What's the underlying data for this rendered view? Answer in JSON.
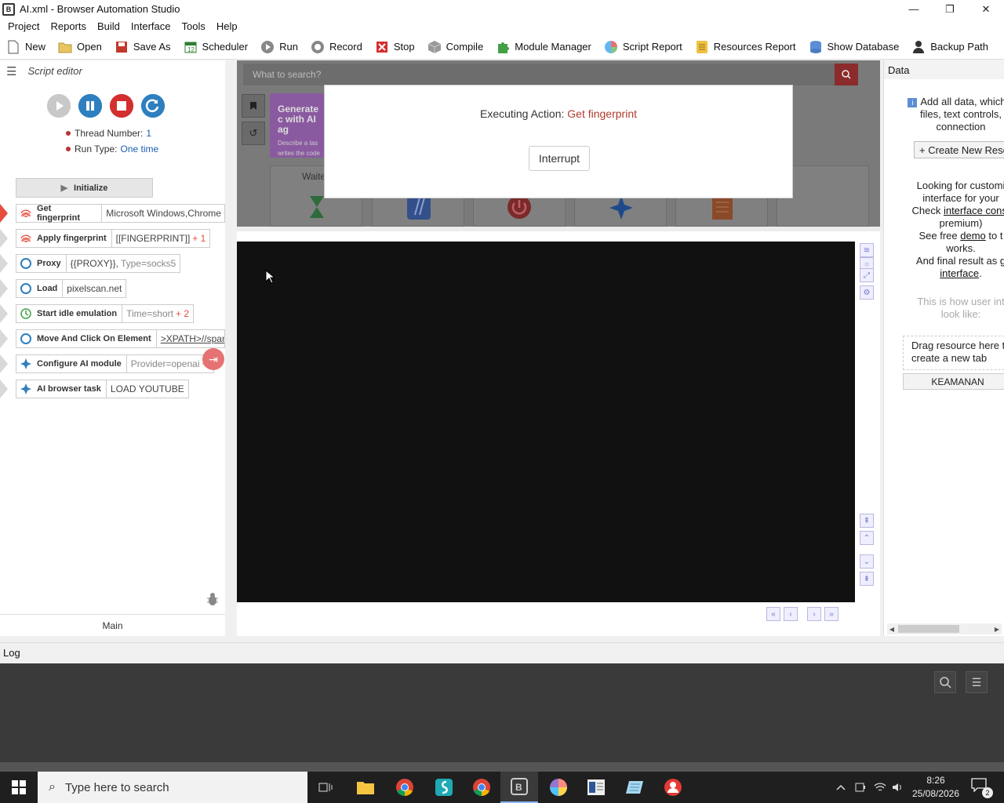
{
  "window": {
    "title": "AI.xml - Browser Automation Studio",
    "app_icon_letter": "B",
    "minimize": "—",
    "maximize": "❐",
    "close": "✕"
  },
  "menu": [
    "Project",
    "Reports",
    "Build",
    "Interface",
    "Tools",
    "Help"
  ],
  "toolbar": [
    {
      "label": "New",
      "icon": "new-file-icon",
      "color": "#ffffff"
    },
    {
      "label": "Open",
      "icon": "open-folder-icon",
      "color": "#e8c560"
    },
    {
      "label": "Save As",
      "icon": "save-icon",
      "color": "#c0392b"
    },
    {
      "label": "Scheduler",
      "icon": "calendar-icon",
      "color": "#2e7d32"
    },
    {
      "label": "Run",
      "icon": "run-icon",
      "color": "#888888"
    },
    {
      "label": "Record",
      "icon": "record-icon",
      "color": "#888888"
    },
    {
      "label": "Stop",
      "icon": "stop-icon",
      "color": "#d32f2f"
    },
    {
      "label": "Compile",
      "icon": "cube-icon",
      "color": "#999999"
    },
    {
      "label": "Module Manager",
      "icon": "puzzle-icon",
      "color": "#43a047"
    },
    {
      "label": "Script Report",
      "icon": "pie-chart-icon",
      "color": "#e57373"
    },
    {
      "label": "Resources Report",
      "icon": "list-icon",
      "color": "#f0c040"
    },
    {
      "label": "Show Database",
      "icon": "database-icon",
      "color": "#5c8ed6"
    },
    {
      "label": "Backup Path",
      "icon": "user-lock-icon",
      "color": "#333333"
    }
  ],
  "script_editor": {
    "title": "Script editor",
    "thread_label": "Thread Number:",
    "thread_value": "1",
    "run_type_label": "Run Type:",
    "run_type_value": "One time",
    "initialize": "Initialize",
    "main_tab": "Main",
    "actions": [
      {
        "name": "Get fingerprint",
        "arg": "Microsoft Windows,Chrome",
        "extra": "+",
        "icon": "fingerprint-icon",
        "active": true
      },
      {
        "name": "Apply fingerprint",
        "arg": "[[FINGERPRINT]]",
        "extra": "+ 1",
        "icon": "fingerprint-icon",
        "active": false
      },
      {
        "name": "Proxy",
        "arg": "{{PROXY}},",
        "dim": "Type=socks5",
        "icon": "globe-icon",
        "active": false
      },
      {
        "name": "Load",
        "arg": "pixelscan.net",
        "icon": "globe-icon",
        "active": false
      },
      {
        "name": "Start idle emulation",
        "arg": "Time=short",
        "extra": "+ 2",
        "icon": "clock-icon",
        "active": false
      },
      {
        "name": "Move And Click On Element",
        "arg": ">XPATH>//span",
        "icon": "globe-icon",
        "active": false
      },
      {
        "name": "Configure AI module",
        "arg": "Provider=openai",
        "extra": "+",
        "icon": "sparkle-icon",
        "active": false
      },
      {
        "name": "AI browser task",
        "arg": "LOAD YOUTUBE",
        "icon": "sparkle-icon",
        "active": false
      }
    ]
  },
  "browser": {
    "search_placeholder": "What to search?",
    "promo_title": "Generate c with AI ag",
    "promo_sub": "Describe a tas writes the code",
    "tile_label": "Waite",
    "modal_label": "Executing Action:",
    "modal_action": "Get fingerprint",
    "interrupt": "Interrupt"
  },
  "data_panel": {
    "title": "Data",
    "line1": "Add all data, which s",
    "line2": "files, text controls,",
    "line3": "connection",
    "create_btn": "+ Create New Reso",
    "custom1": "Looking for customi",
    "custom2": "interface for your",
    "custom3_pre": "Check ",
    "custom3_link": "interface const",
    "custom4": "premium)",
    "demo_pre": "See free ",
    "demo_link": "demo",
    "demo_post": " to t",
    "works": "works.",
    "final_pre": "And final result as ",
    "final_link": "g",
    "final_link2": "interface",
    "final_post": ".",
    "howto1": "This is how user int",
    "howto2": "look like:",
    "drag1": "Drag resource here t",
    "drag2": "create a new tab",
    "keamanan": "KEAMANAN"
  },
  "log": {
    "title": "Log"
  },
  "taskbar": {
    "search_placeholder": "Type here to search",
    "time": "8:26",
    "date": "25/08/2026",
    "notifications": "2"
  }
}
